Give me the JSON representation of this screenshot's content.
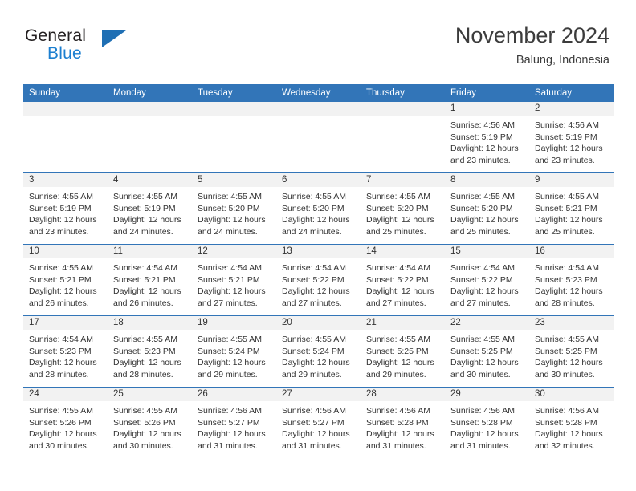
{
  "brand": {
    "name_part1": "General",
    "name_part2": "Blue",
    "triangle_color": "#1f6fb4",
    "blue_color": "#1c7fd0"
  },
  "header": {
    "month_title": "November 2024",
    "location": "Balung, Indonesia"
  },
  "theme": {
    "header_blue": "#3275b8",
    "daynum_band": "#f2f2f2",
    "text": "#333333"
  },
  "weekday_headers": [
    "Sunday",
    "Monday",
    "Tuesday",
    "Wednesday",
    "Thursday",
    "Friday",
    "Saturday"
  ],
  "weeks": [
    [
      {
        "day": "",
        "sunrise": "",
        "sunset": "",
        "daylight_1": "",
        "daylight_2": ""
      },
      {
        "day": "",
        "sunrise": "",
        "sunset": "",
        "daylight_1": "",
        "daylight_2": ""
      },
      {
        "day": "",
        "sunrise": "",
        "sunset": "",
        "daylight_1": "",
        "daylight_2": ""
      },
      {
        "day": "",
        "sunrise": "",
        "sunset": "",
        "daylight_1": "",
        "daylight_2": ""
      },
      {
        "day": "",
        "sunrise": "",
        "sunset": "",
        "daylight_1": "",
        "daylight_2": ""
      },
      {
        "day": "1",
        "sunrise": "Sunrise: 4:56 AM",
        "sunset": "Sunset: 5:19 PM",
        "daylight_1": "Daylight: 12 hours",
        "daylight_2": "and 23 minutes."
      },
      {
        "day": "2",
        "sunrise": "Sunrise: 4:56 AM",
        "sunset": "Sunset: 5:19 PM",
        "daylight_1": "Daylight: 12 hours",
        "daylight_2": "and 23 minutes."
      }
    ],
    [
      {
        "day": "3",
        "sunrise": "Sunrise: 4:55 AM",
        "sunset": "Sunset: 5:19 PM",
        "daylight_1": "Daylight: 12 hours",
        "daylight_2": "and 23 minutes."
      },
      {
        "day": "4",
        "sunrise": "Sunrise: 4:55 AM",
        "sunset": "Sunset: 5:19 PM",
        "daylight_1": "Daylight: 12 hours",
        "daylight_2": "and 24 minutes."
      },
      {
        "day": "5",
        "sunrise": "Sunrise: 4:55 AM",
        "sunset": "Sunset: 5:20 PM",
        "daylight_1": "Daylight: 12 hours",
        "daylight_2": "and 24 minutes."
      },
      {
        "day": "6",
        "sunrise": "Sunrise: 4:55 AM",
        "sunset": "Sunset: 5:20 PM",
        "daylight_1": "Daylight: 12 hours",
        "daylight_2": "and 24 minutes."
      },
      {
        "day": "7",
        "sunrise": "Sunrise: 4:55 AM",
        "sunset": "Sunset: 5:20 PM",
        "daylight_1": "Daylight: 12 hours",
        "daylight_2": "and 25 minutes."
      },
      {
        "day": "8",
        "sunrise": "Sunrise: 4:55 AM",
        "sunset": "Sunset: 5:20 PM",
        "daylight_1": "Daylight: 12 hours",
        "daylight_2": "and 25 minutes."
      },
      {
        "day": "9",
        "sunrise": "Sunrise: 4:55 AM",
        "sunset": "Sunset: 5:21 PM",
        "daylight_1": "Daylight: 12 hours",
        "daylight_2": "and 25 minutes."
      }
    ],
    [
      {
        "day": "10",
        "sunrise": "Sunrise: 4:55 AM",
        "sunset": "Sunset: 5:21 PM",
        "daylight_1": "Daylight: 12 hours",
        "daylight_2": "and 26 minutes."
      },
      {
        "day": "11",
        "sunrise": "Sunrise: 4:54 AM",
        "sunset": "Sunset: 5:21 PM",
        "daylight_1": "Daylight: 12 hours",
        "daylight_2": "and 26 minutes."
      },
      {
        "day": "12",
        "sunrise": "Sunrise: 4:54 AM",
        "sunset": "Sunset: 5:21 PM",
        "daylight_1": "Daylight: 12 hours",
        "daylight_2": "and 27 minutes."
      },
      {
        "day": "13",
        "sunrise": "Sunrise: 4:54 AM",
        "sunset": "Sunset: 5:22 PM",
        "daylight_1": "Daylight: 12 hours",
        "daylight_2": "and 27 minutes."
      },
      {
        "day": "14",
        "sunrise": "Sunrise: 4:54 AM",
        "sunset": "Sunset: 5:22 PM",
        "daylight_1": "Daylight: 12 hours",
        "daylight_2": "and 27 minutes."
      },
      {
        "day": "15",
        "sunrise": "Sunrise: 4:54 AM",
        "sunset": "Sunset: 5:22 PM",
        "daylight_1": "Daylight: 12 hours",
        "daylight_2": "and 27 minutes."
      },
      {
        "day": "16",
        "sunrise": "Sunrise: 4:54 AM",
        "sunset": "Sunset: 5:23 PM",
        "daylight_1": "Daylight: 12 hours",
        "daylight_2": "and 28 minutes."
      }
    ],
    [
      {
        "day": "17",
        "sunrise": "Sunrise: 4:54 AM",
        "sunset": "Sunset: 5:23 PM",
        "daylight_1": "Daylight: 12 hours",
        "daylight_2": "and 28 minutes."
      },
      {
        "day": "18",
        "sunrise": "Sunrise: 4:55 AM",
        "sunset": "Sunset: 5:23 PM",
        "daylight_1": "Daylight: 12 hours",
        "daylight_2": "and 28 minutes."
      },
      {
        "day": "19",
        "sunrise": "Sunrise: 4:55 AM",
        "sunset": "Sunset: 5:24 PM",
        "daylight_1": "Daylight: 12 hours",
        "daylight_2": "and 29 minutes."
      },
      {
        "day": "20",
        "sunrise": "Sunrise: 4:55 AM",
        "sunset": "Sunset: 5:24 PM",
        "daylight_1": "Daylight: 12 hours",
        "daylight_2": "and 29 minutes."
      },
      {
        "day": "21",
        "sunrise": "Sunrise: 4:55 AM",
        "sunset": "Sunset: 5:25 PM",
        "daylight_1": "Daylight: 12 hours",
        "daylight_2": "and 29 minutes."
      },
      {
        "day": "22",
        "sunrise": "Sunrise: 4:55 AM",
        "sunset": "Sunset: 5:25 PM",
        "daylight_1": "Daylight: 12 hours",
        "daylight_2": "and 30 minutes."
      },
      {
        "day": "23",
        "sunrise": "Sunrise: 4:55 AM",
        "sunset": "Sunset: 5:25 PM",
        "daylight_1": "Daylight: 12 hours",
        "daylight_2": "and 30 minutes."
      }
    ],
    [
      {
        "day": "24",
        "sunrise": "Sunrise: 4:55 AM",
        "sunset": "Sunset: 5:26 PM",
        "daylight_1": "Daylight: 12 hours",
        "daylight_2": "and 30 minutes."
      },
      {
        "day": "25",
        "sunrise": "Sunrise: 4:55 AM",
        "sunset": "Sunset: 5:26 PM",
        "daylight_1": "Daylight: 12 hours",
        "daylight_2": "and 30 minutes."
      },
      {
        "day": "26",
        "sunrise": "Sunrise: 4:56 AM",
        "sunset": "Sunset: 5:27 PM",
        "daylight_1": "Daylight: 12 hours",
        "daylight_2": "and 31 minutes."
      },
      {
        "day": "27",
        "sunrise": "Sunrise: 4:56 AM",
        "sunset": "Sunset: 5:27 PM",
        "daylight_1": "Daylight: 12 hours",
        "daylight_2": "and 31 minutes."
      },
      {
        "day": "28",
        "sunrise": "Sunrise: 4:56 AM",
        "sunset": "Sunset: 5:28 PM",
        "daylight_1": "Daylight: 12 hours",
        "daylight_2": "and 31 minutes."
      },
      {
        "day": "29",
        "sunrise": "Sunrise: 4:56 AM",
        "sunset": "Sunset: 5:28 PM",
        "daylight_1": "Daylight: 12 hours",
        "daylight_2": "and 31 minutes."
      },
      {
        "day": "30",
        "sunrise": "Sunrise: 4:56 AM",
        "sunset": "Sunset: 5:28 PM",
        "daylight_1": "Daylight: 12 hours",
        "daylight_2": "and 32 minutes."
      }
    ]
  ]
}
